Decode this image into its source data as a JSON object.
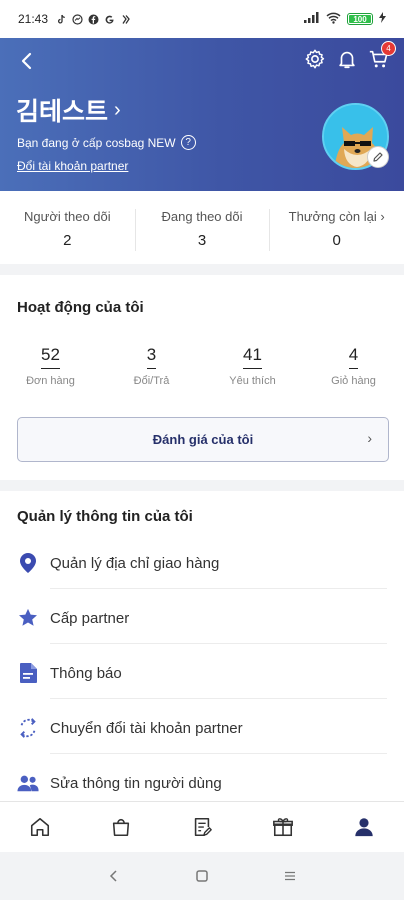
{
  "status_bar": {
    "time": "21:43",
    "battery": "100",
    "notif_icons": [
      "tiktok-icon",
      "messenger-icon",
      "facebook-icon",
      "google-icon",
      "app-icon"
    ]
  },
  "header": {
    "username": "김테스트",
    "tier_text": "Bạn đang ở cấp cosbag NEW",
    "switch_link": "Đổi tài khoản partner",
    "cart_count": "4",
    "bg_color_start": "#4b6fb9",
    "bg_color_end": "#3b4a9d"
  },
  "stats": [
    {
      "label": "Người theo dõi",
      "value": "2"
    },
    {
      "label": "Đang theo dõi",
      "value": "3"
    },
    {
      "label": "Thưởng còn lại",
      "value": "0"
    }
  ],
  "activity": {
    "title": "Hoạt động của tôi",
    "items": [
      {
        "value": "52",
        "label": "Đơn hàng"
      },
      {
        "value": "3",
        "label": "Đổi/Trả"
      },
      {
        "value": "41",
        "label": "Yêu thích"
      },
      {
        "value": "4",
        "label": "Giỏ hàng"
      }
    ],
    "review_button": "Đánh giá của tôi"
  },
  "manage": {
    "title": "Quản lý thông tin của tôi",
    "items": [
      {
        "label": "Quản lý địa chỉ giao hàng",
        "icon": "location-pin-icon"
      },
      {
        "label": "Cấp partner",
        "icon": "star-icon"
      },
      {
        "label": "Thông báo",
        "icon": "document-icon"
      },
      {
        "label": "Chuyển đổi tài khoản partner",
        "icon": "switch-account-icon"
      },
      {
        "label": "Sửa thông tin người dùng",
        "icon": "users-icon"
      }
    ]
  },
  "bottom_nav": [
    "home-icon",
    "shopping-bag-icon",
    "notes-icon",
    "gift-box-icon",
    "profile-icon"
  ],
  "accent_color": "#3b4bb0"
}
